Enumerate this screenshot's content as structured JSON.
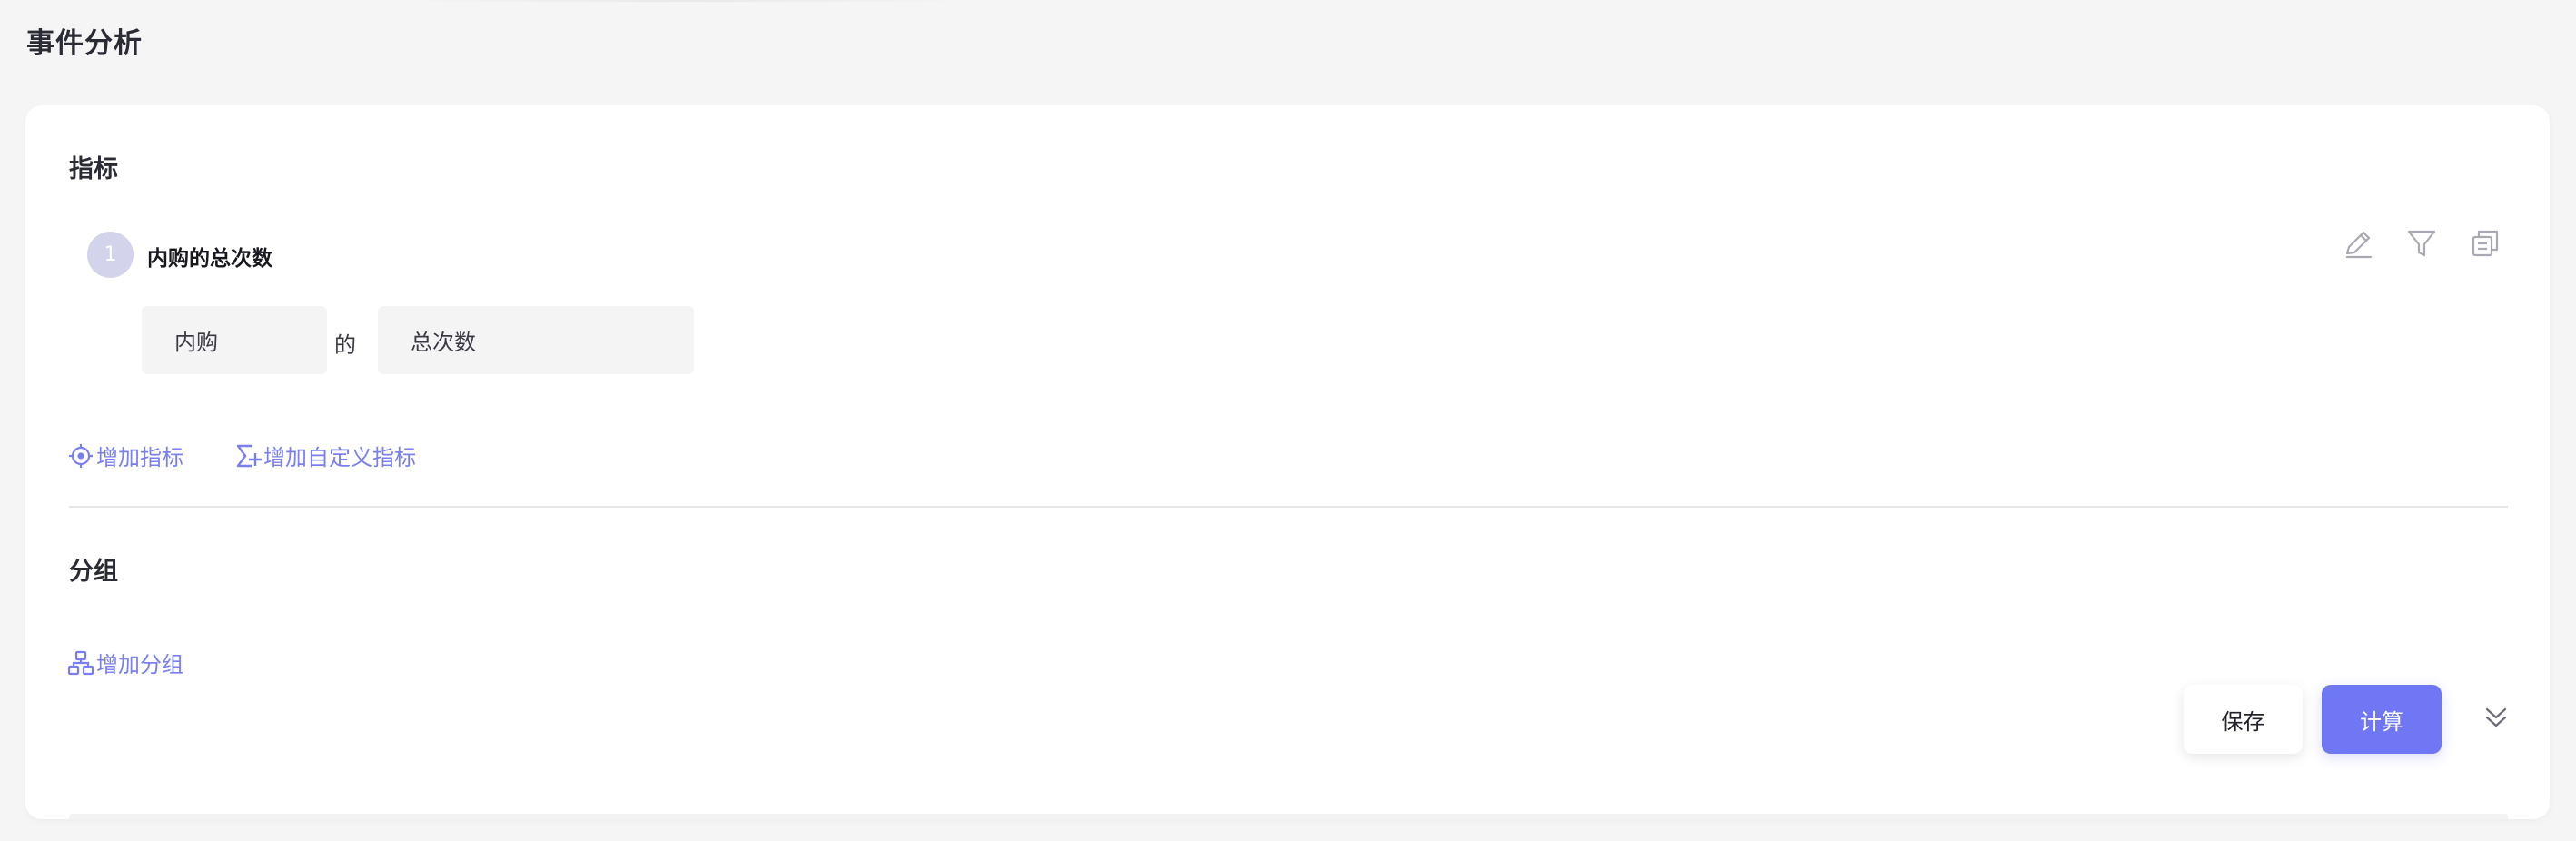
{
  "page": {
    "title": "事件分析"
  },
  "metrics_section": {
    "title": "指标",
    "metric": {
      "index": "1",
      "name": "内购的总次数",
      "event_value": "内购",
      "connector": "的",
      "measure_value": "总次数"
    },
    "tools": [
      "edit-icon",
      "filter-icon",
      "copy-icon"
    ],
    "add_metric_label": "增加指标",
    "add_custom_metric_label": "增加自定义指标"
  },
  "group_section": {
    "title": "分组",
    "add_group_label": "增加分组"
  },
  "actions": {
    "save_label": "保存",
    "compute_label": "计算"
  },
  "colors": {
    "accent": "#7077f5",
    "link": "#7a7ff0",
    "background": "#f5f5f6",
    "card": "#ffffff"
  }
}
